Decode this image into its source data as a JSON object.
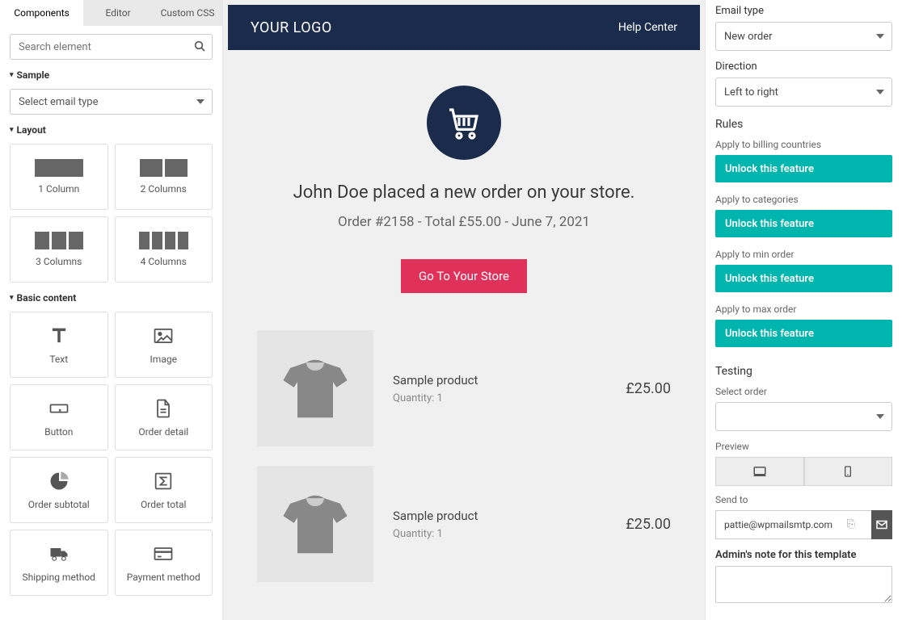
{
  "tabs": {
    "components": "Components",
    "editor": "Editor",
    "css": "Custom CSS"
  },
  "search": {
    "placeholder": "Search element"
  },
  "sections": {
    "sample": "Sample",
    "layout": "Layout",
    "basic": "Basic content"
  },
  "sample_select": "Select email type",
  "layout_tiles": [
    "1 Column",
    "2 Columns",
    "3 Columns",
    "4 Columns"
  ],
  "basic_tiles": [
    "Text",
    "Image",
    "Button",
    "Order detail",
    "Order subtotal",
    "Order total",
    "Shipping method",
    "Payment method"
  ],
  "email": {
    "header_logo": "YOUR LOGO",
    "help": "Help Center",
    "msg": "John Doe placed a new order on your store.",
    "meta": "Order #2158 - Total £55.00 - June 7, 2021",
    "cta": "Go To Your Store",
    "products": [
      {
        "name": "Sample product",
        "qty": "Quantity: 1",
        "price": "£25.00"
      },
      {
        "name": "Sample product",
        "qty": "Quantity: 1",
        "price": "£25.00"
      }
    ]
  },
  "right": {
    "email_type_lbl": "Email type",
    "email_type": "New order",
    "direction_lbl": "Direction",
    "direction": "Left to right",
    "rules": "Rules",
    "apply_billing": "Apply to billing countries",
    "apply_cat": "Apply to categories",
    "apply_min": "Apply to min order",
    "apply_max": "Apply to max order",
    "unlock": "Unlock this feature",
    "testing": "Testing",
    "select_order": "Select order",
    "preview": "Preview",
    "sendto": "Send to",
    "sendto_val": "pattie@wpmailsmtp.com",
    "note": "Admin's note for this template"
  }
}
